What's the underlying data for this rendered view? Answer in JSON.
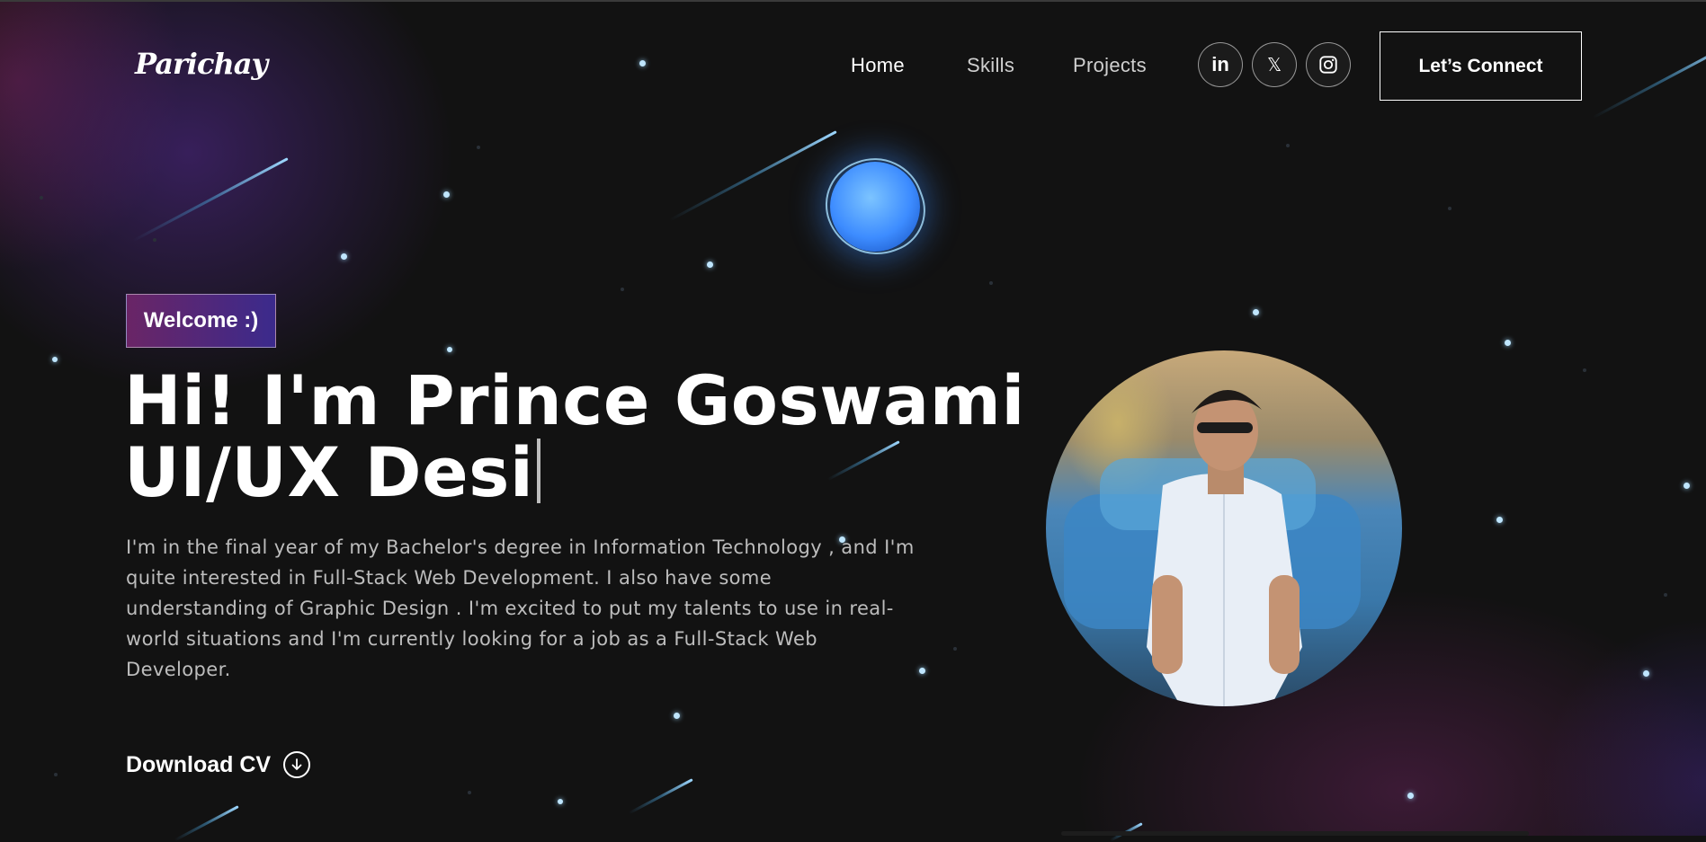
{
  "nav": {
    "logo": "Parichay",
    "links": [
      {
        "label": "Home",
        "active": true
      },
      {
        "label": "Skills",
        "active": false
      },
      {
        "label": "Projects",
        "active": false
      }
    ],
    "socials": [
      {
        "icon": "linkedin-icon",
        "glyph": "in"
      },
      {
        "icon": "x-icon",
        "glyph": "𝕏"
      },
      {
        "icon": "instagram-icon",
        "glyph": ""
      }
    ],
    "connect_label": "Let’s Connect"
  },
  "hero": {
    "badge": "Welcome :)",
    "headline_line1": "Hi! I'm Prince Goswami",
    "headline_line2": "UI/UX Desi",
    "bio": "I'm in the final year of my Bachelor's degree in Information Technology , and I'm quite interested in Full-Stack Web Development. I also have some understanding of Graphic Design . I'm excited to put my talents to use in real-world situations and I'm currently looking for a job as a Full-Stack Web Developer.",
    "download_label": "Download CV"
  },
  "avatar": {
    "icon": "profile-photo"
  },
  "colors": {
    "background": "#121212",
    "badge_gradient_start": "#6a2566",
    "badge_gradient_end": "#3b2a8c",
    "orb": "#3d8cff",
    "star": "#bfe6ff"
  }
}
